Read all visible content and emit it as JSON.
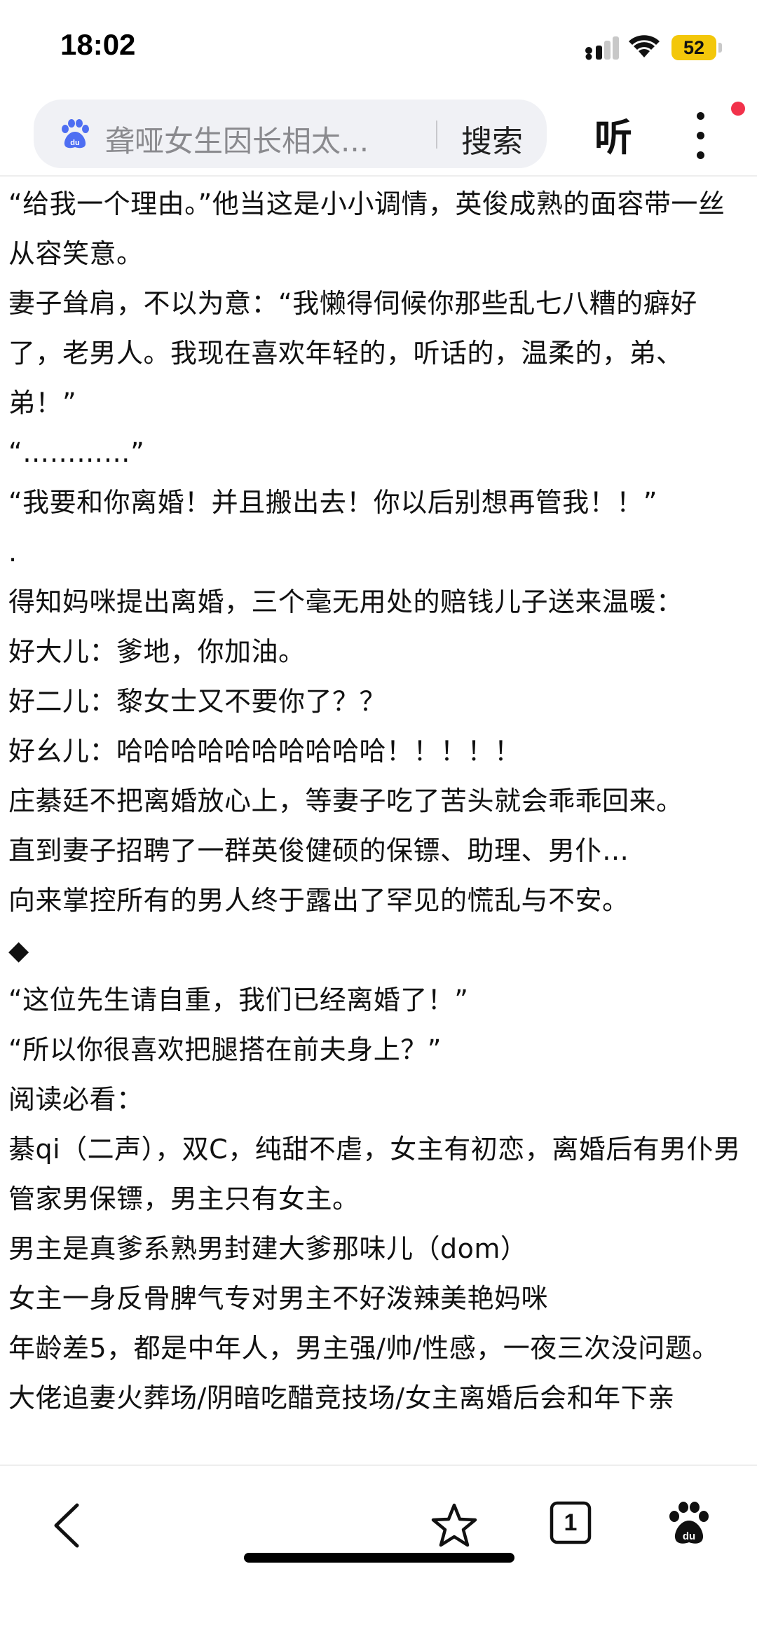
{
  "status_bar": {
    "time": "18:02",
    "battery": "52",
    "icons": [
      "signal-icon",
      "wifi-icon",
      "battery-icon"
    ],
    "battery_color": "#f3c70a"
  },
  "header": {
    "search_query": "聋哑女生因长相太...",
    "search_button": "搜索",
    "listen_button": "听",
    "icons": [
      "baidu-paw-icon",
      "more-icon",
      "notification-dot"
    ],
    "notification_color": "#f2324b"
  },
  "article": {
    "paragraphs": [
      "“给我一个理由。”他当这是小小调情，英俊成熟的面容带一丝从容笑意。",
      "妻子耸肩，不以为意：“我懒得伺候你那些乱七八糟的癖好了，老男人。我现在喜欢年轻的，听话的，温柔的，弟、弟！”",
      "“…………”",
      "“我要和你离婚！并且搬出去！你以后别想再管我！！”",
      ".",
      "得知妈咪提出离婚，三个毫无用处的赔钱儿子送来温暖：",
      "好大儿：爹地，你加油。",
      "好二儿：黎女士又不要你了？？",
      "好幺儿：哈哈哈哈哈哈哈哈哈哈！！！！！",
      "庄綦廷不把离婚放心上，等妻子吃了苦头就会乖乖回来。",
      "直到妻子招聘了一群英俊健硕的保镖、助理、男仆…",
      "向来掌控所有的男人终于露出了罕见的慌乱与不安。",
      "◆",
      "“这位先生请自重，我们已经离婚了！”",
      "“所以你很喜欢把腿搭在前夫身上？”",
      "阅读必看：",
      "綦qi（二声），双C，纯甜不虐，女主有初恋，离婚后有男仆男管家男保镖，男主只有女主。",
      "男主是真爹系熟男封建大爹那味儿（dom）",
      "女主一身反骨脾气专对男主不好泼辣美艳妈咪",
      "年龄差5，都是中年人，男主强/帅/性感，一夜三次没问题。",
      "大佬追妻火葬场/阴暗吃醋竞技场/女主离婚后会和年下亲"
    ]
  },
  "bottom_bar": {
    "tab_count": "1",
    "icons": [
      "back-icon",
      "star-icon",
      "tabs-icon",
      "baidu-icon"
    ]
  }
}
